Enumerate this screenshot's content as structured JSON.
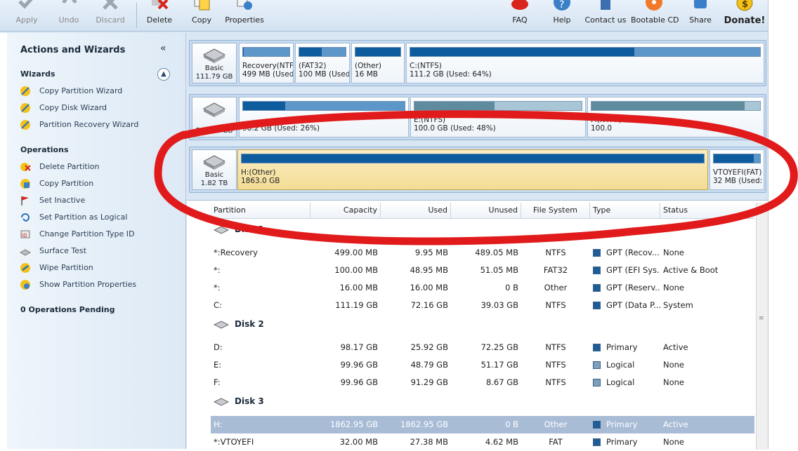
{
  "toolbar": {
    "apply": "Apply",
    "undo": "Undo",
    "discard": "Discard",
    "delete": "Delete",
    "copy": "Copy",
    "properties": "Properties",
    "faq": "FAQ",
    "help": "Help",
    "contact": "Contact us",
    "bootable": "Bootable CD",
    "share": "Share",
    "donate": "Donate!"
  },
  "sidebar": {
    "title": "Actions and Wizards",
    "collapse_glyph": "«",
    "wizards_title": "Wizards",
    "wizards": [
      "Copy Partition Wizard",
      "Copy Disk Wizard",
      "Partition Recovery Wizard"
    ],
    "operations_title": "Operations",
    "operations": [
      "Delete Partition",
      "Copy Partition",
      "Set Inactive",
      "Set Partition as Logical",
      "Change Partition Type ID",
      "Surface Test",
      "Wipe Partition",
      "Show Partition Properties"
    ],
    "pending": "0 Operations Pending"
  },
  "diskmap": {
    "disk1": {
      "type": "Basic",
      "size": "111.79 GB",
      "partitions": [
        {
          "name": "Recovery(NTF",
          "detail": "499 MB (Used:",
          "used_pct": 2
        },
        {
          "name": "(FAT32)",
          "detail": "100 MB (Used:",
          "used_pct": 49
        },
        {
          "name": "(Other)",
          "detail": "16 MB",
          "used_pct": 100
        },
        {
          "name": "C:(NTFS)",
          "detail": "111.2 GB (Used: 64%)",
          "used_pct": 64
        }
      ]
    },
    "disk2": {
      "type": "",
      "size": "298.09 GB",
      "partitions": [
        {
          "name": "",
          "detail": "98.2 GB (Used: 26%)",
          "used_pct": 26
        },
        {
          "name": "E:(NTFS)",
          "detail": "100.0 GB (Used: 48%)",
          "used_pct": 48
        },
        {
          "name": "F:(NTFS)",
          "detail": "100.0",
          "used_pct": 91
        }
      ]
    },
    "disk3": {
      "type": "Basic",
      "size": "1.82 TB",
      "partitions": [
        {
          "name": "H:(Other)",
          "detail": "1863.0 GB",
          "used_pct": 100
        },
        {
          "name": "VTOYEFI(FAT)",
          "detail": "32 MB (Used: 8",
          "used_pct": 86
        }
      ]
    }
  },
  "table": {
    "headers": [
      "Partition",
      "Capacity",
      "Used",
      "Unused",
      "File System",
      "Type",
      "Status"
    ],
    "disk1_label": "Disk 1",
    "disk1_rows": [
      {
        "partition": "*:Recovery",
        "capacity": "499.00 MB",
        "used": "9.95 MB",
        "unused": "489.05 MB",
        "fs": "NTFS",
        "type": "GPT (Recov...",
        "status": "None"
      },
      {
        "partition": "*:",
        "capacity": "100.00 MB",
        "used": "48.95 MB",
        "unused": "51.05 MB",
        "fs": "FAT32",
        "type": "GPT (EFI Sys...",
        "status": "Active & Boot"
      },
      {
        "partition": "*:",
        "capacity": "16.00 MB",
        "used": "16.00 MB",
        "unused": "0 B",
        "fs": "Other",
        "type": "GPT (Reserv...",
        "status": "None"
      },
      {
        "partition": "C:",
        "capacity": "111.19 GB",
        "used": "72.16 GB",
        "unused": "39.03 GB",
        "fs": "NTFS",
        "type": "GPT (Data P...",
        "status": "System"
      }
    ],
    "disk2_label": "Disk 2",
    "disk2_rows": [
      {
        "partition": "D:",
        "capacity": "98.17 GB",
        "used": "25.92 GB",
        "unused": "72.25 GB",
        "fs": "NTFS",
        "type": "Primary",
        "status": "Active"
      },
      {
        "partition": "E:",
        "capacity": "99.96 GB",
        "used": "48.79 GB",
        "unused": "51.17 GB",
        "fs": "NTFS",
        "type": "Logical",
        "status": "None"
      },
      {
        "partition": "F:",
        "capacity": "99.96 GB",
        "used": "91.29 GB",
        "unused": "8.67 GB",
        "fs": "NTFS",
        "type": "Logical",
        "status": "None"
      }
    ],
    "disk3_label": "Disk 3",
    "disk3_rows": [
      {
        "partition": "H:",
        "capacity": "1862.95 GB",
        "used": "1862.95 GB",
        "unused": "0 B",
        "fs": "Other",
        "type": "Primary",
        "status": "Active"
      },
      {
        "partition": "*:VTOYEFI",
        "capacity": "32.00 MB",
        "used": "27.38 MB",
        "unused": "4.62 MB",
        "fs": "FAT",
        "type": "Primary",
        "status": "None"
      }
    ]
  },
  "colors": {
    "accent": "#0e5c9e",
    "selected_partition": "#f3dc95",
    "selected_row": "#a8bcd6",
    "annotation": "#e11b1b"
  }
}
